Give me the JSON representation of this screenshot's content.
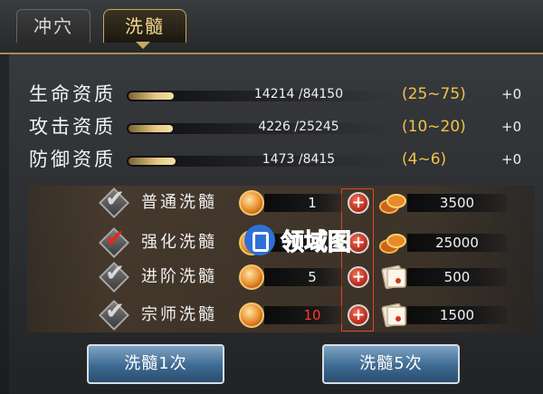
{
  "tabs": [
    {
      "label": "冲穴",
      "active": false
    },
    {
      "label": "洗髓",
      "active": true
    }
  ],
  "stats": [
    {
      "label": "生命资质",
      "value": "14214 /84150",
      "range": "(25~75)",
      "bonus": "+0",
      "fill": 0.169
    },
    {
      "label": "攻击资质",
      "value": "4226 /25245",
      "range": "(10~20)",
      "bonus": "+0",
      "fill": 0.167
    },
    {
      "label": "防御资质",
      "value": "1473 /8415",
      "range": "(4~6)",
      "bonus": "+0",
      "fill": 0.175
    }
  ],
  "options": [
    {
      "label": "普通洗髓",
      "checked": false,
      "count": "1",
      "count_red": false,
      "cost": "3500",
      "cost_type": "gold-coins"
    },
    {
      "label": "强化洗髓",
      "checked": true,
      "count": "",
      "count_red": false,
      "cost": "25000",
      "cost_type": "gold-coins"
    },
    {
      "label": "进阶洗髓",
      "checked": false,
      "count": "5",
      "count_red": false,
      "cost": "500",
      "cost_type": "scroll"
    },
    {
      "label": "宗师洗髓",
      "checked": false,
      "count": "10",
      "count_red": true,
      "cost": "1500",
      "cost_type": "scroll"
    }
  ],
  "buttons": {
    "wash_once": "洗髓1次",
    "wash_five": "洗髓5次"
  },
  "watermark": "领域图",
  "colors": {
    "accent_gold": "#f3c24a",
    "check_red": "#e5281c",
    "button_blue": "#3e6a92"
  }
}
